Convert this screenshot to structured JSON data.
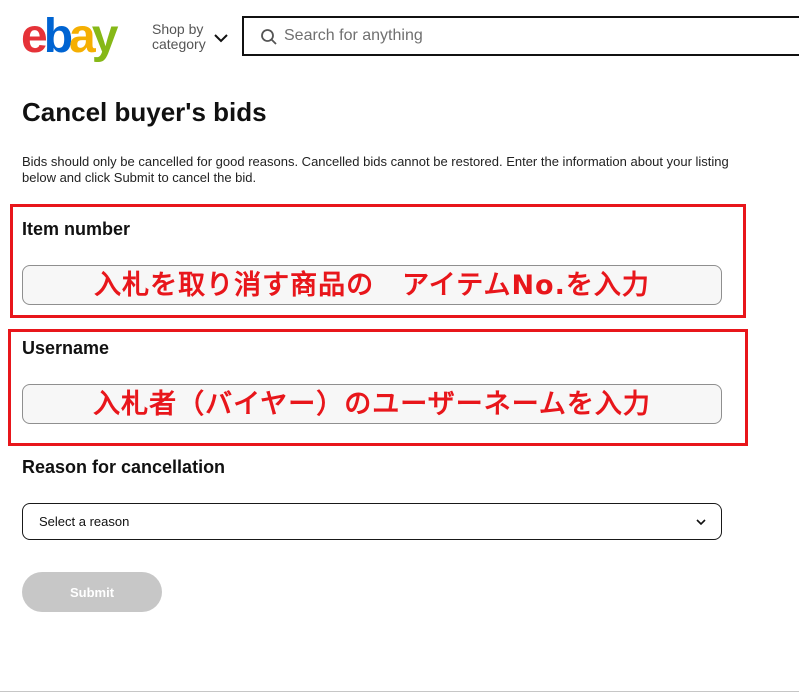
{
  "header": {
    "logo": {
      "letters": [
        "e",
        "b",
        "a",
        "y"
      ],
      "colors": [
        "#e53238",
        "#0064d2",
        "#f5af02",
        "#86b817"
      ]
    },
    "shop_by_category": [
      "Shop by",
      "category"
    ],
    "search": {
      "placeholder": "Search for anything"
    }
  },
  "main": {
    "title": "Cancel buyer's bids",
    "intro": "Bids should only be cancelled for good reasons. Cancelled bids cannot be restored. Enter the information about your listing below and click Submit to cancel the bid.",
    "fields": {
      "item_number": {
        "label": "Item number",
        "note": "入札を取り消す商品の　アイテムNo.を入力"
      },
      "username": {
        "label": "Username",
        "note": "入札者（バイヤー）のユーザーネームを入力"
      }
    },
    "reason": {
      "label": "Reason for cancellation",
      "selected": "Select a reason"
    },
    "submit_label": "Submit"
  },
  "colors": {
    "highlight": "#e8161b",
    "disabled_button": "#c7c7c7"
  }
}
